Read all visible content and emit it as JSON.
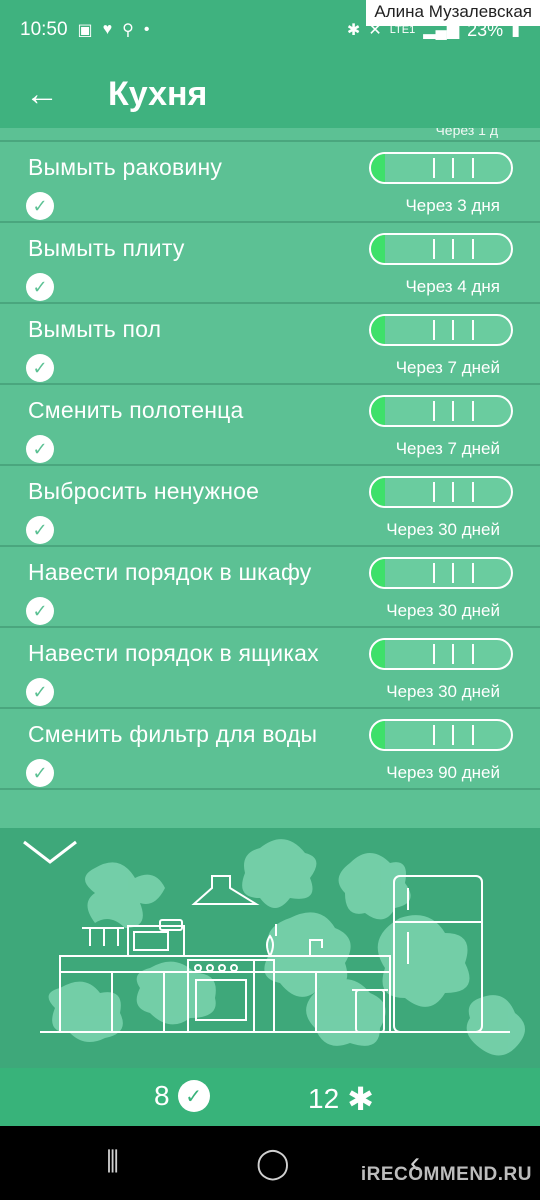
{
  "status_bar": {
    "time": "10:50",
    "battery": "23%",
    "network": "LTE1"
  },
  "watermark_top": "Алина Музалевская",
  "app_bar": {
    "title": "Кухня",
    "back_icon": "arrow-left-icon"
  },
  "peek_text": "Через 1 д",
  "tasks": [
    {
      "title": "Вымыть раковину",
      "due": "Через 3 дня",
      "progress": 0.1
    },
    {
      "title": "Вымыть плиту",
      "due": "Через 4 дня",
      "progress": 0.1
    },
    {
      "title": "Вымыть пол",
      "due": "Через 7 дней",
      "progress": 0.1
    },
    {
      "title": "Сменить полотенца",
      "due": "Через 7 дней",
      "progress": 0.1
    },
    {
      "title": "Выбросить ненужное",
      "due": "Через 30 дней",
      "progress": 0.1
    },
    {
      "title": "Навести порядок в шкафу",
      "due": "Через 30 дней",
      "progress": 0.1
    },
    {
      "title": "Навести порядок в  ящиках",
      "due": "Через 30 дней",
      "progress": 0.1
    },
    {
      "title": "Сменить фильтр для воды",
      "due": "Через 90 дней",
      "progress": 0.1
    }
  ],
  "stats": {
    "done_count": "8",
    "star_count": "12"
  },
  "watermark_bottom": "iRECOMMEND.RU"
}
